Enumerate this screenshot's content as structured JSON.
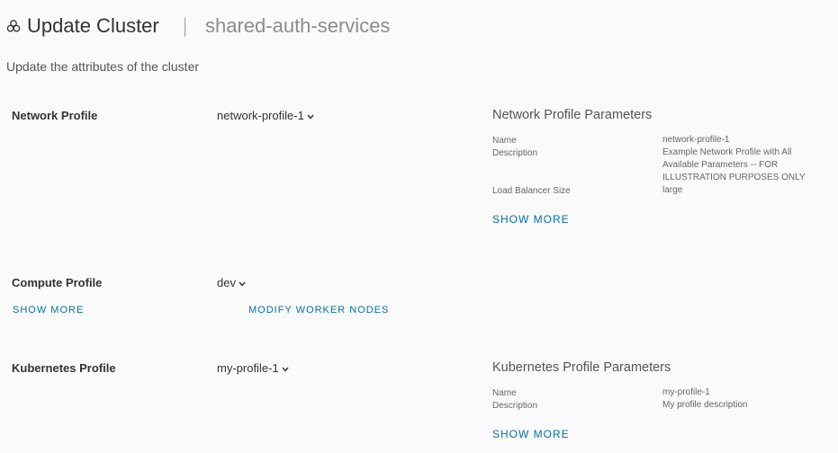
{
  "header": {
    "title": "Update Cluster",
    "subtitle": "shared-auth-services",
    "description": "Update the attributes of the cluster"
  },
  "network_profile": {
    "label": "Network Profile",
    "selected": "network-profile-1",
    "params_title": "Network Profile Parameters",
    "params": [
      {
        "key": "Name",
        "value": "network-profile-1"
      },
      {
        "key": "Description",
        "value": "Example Network Profile with All Available Parameters -- FOR ILLUSTRATION PURPOSES ONLY"
      },
      {
        "key": "Load Balancer Size",
        "value": "large"
      }
    ],
    "show_more": "SHOW MORE"
  },
  "compute_profile": {
    "label": "Compute Profile",
    "selected": "dev",
    "show_more": "SHOW MORE",
    "modify_worker_nodes": "MODIFY WORKER NODES"
  },
  "kubernetes_profile": {
    "label": "Kubernetes Profile",
    "selected": "my-profile-1",
    "params_title": "Kubernetes Profile Parameters",
    "params": [
      {
        "key": "Name",
        "value": "my-profile-1"
      },
      {
        "key": "Description",
        "value": "My profile description"
      }
    ],
    "show_more": "SHOW MORE"
  },
  "icons": {
    "cluster": "cluster-icon",
    "chevron": "chevron-down-icon"
  },
  "colors": {
    "link": "#0072a3",
    "background": "#fafafa"
  }
}
